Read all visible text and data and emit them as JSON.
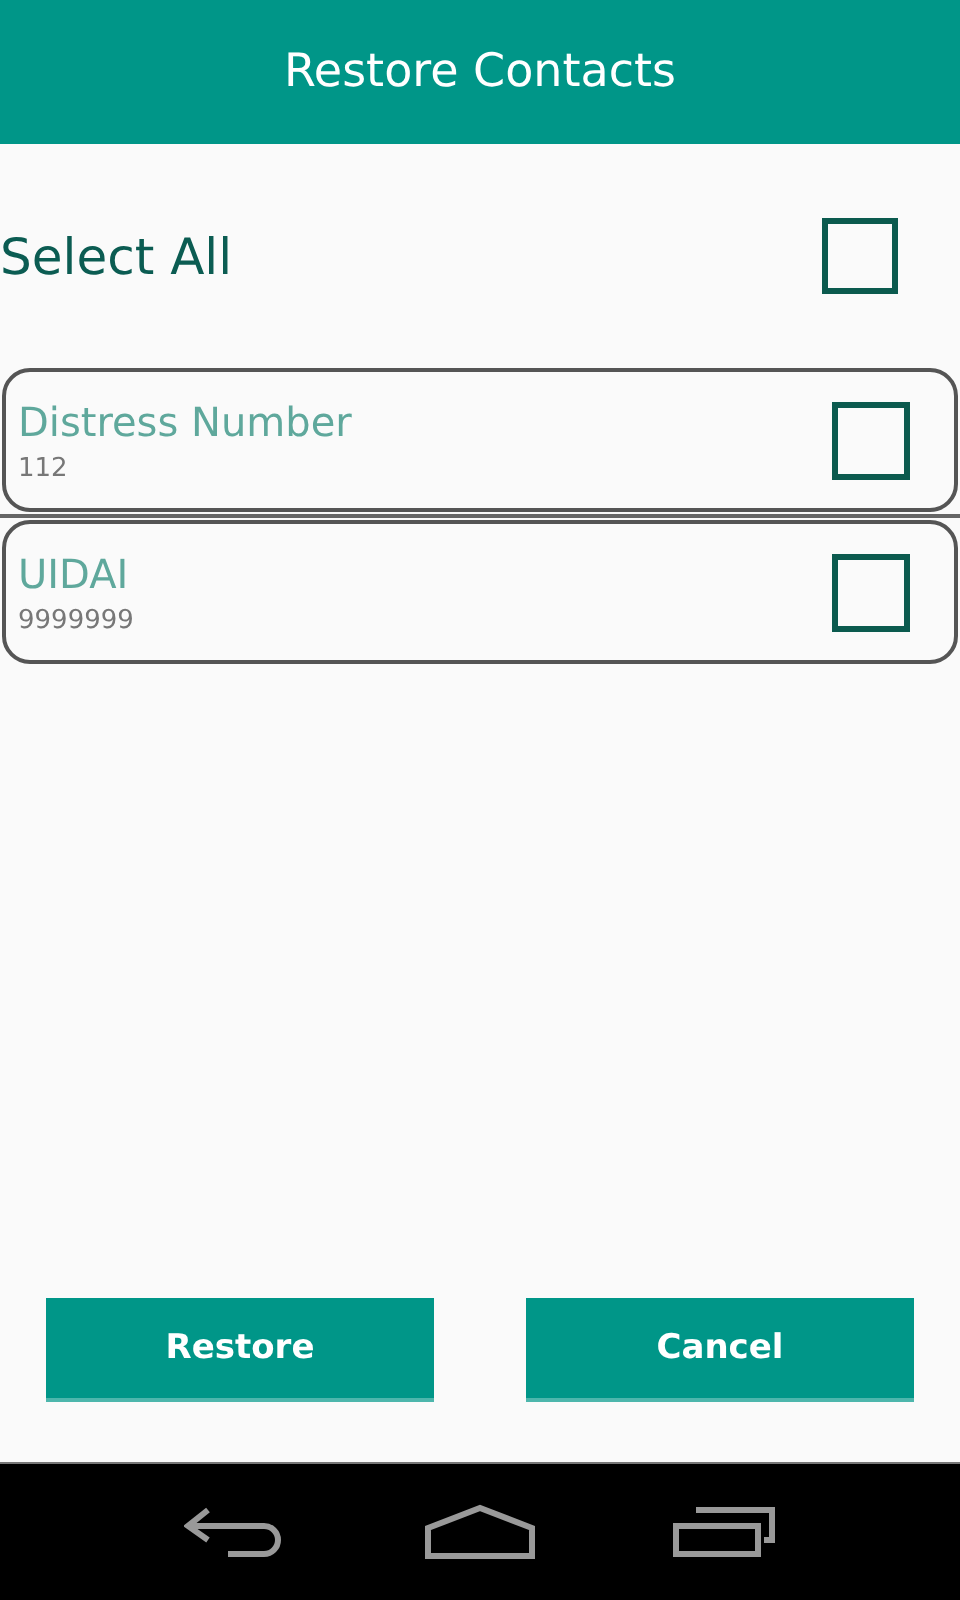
{
  "title": "Restore Contacts",
  "select_all": {
    "label": "Select All",
    "checked": false
  },
  "contacts": [
    {
      "name": "Distress Number",
      "number": "112",
      "checked": false
    },
    {
      "name": "UIDAI",
      "number": "9999999",
      "checked": false
    }
  ],
  "buttons": [
    "Restore",
    "Cancel"
  ]
}
